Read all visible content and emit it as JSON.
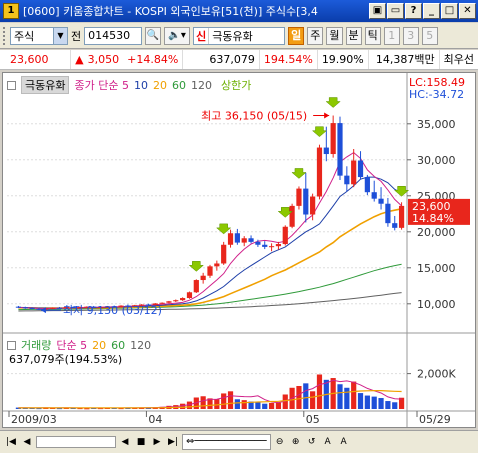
{
  "window": {
    "icon": "1",
    "title": "[0600] 키움종합차트 - KOSPI 외국인보유[51(천)] 주식수[3,4",
    "buttons": [
      "▣",
      "▭",
      "?",
      "_",
      "□",
      "✕"
    ]
  },
  "toolbar": {
    "market": "주식",
    "jeon_label": "전",
    "code": "014530",
    "sin_badge": "신",
    "stock_name": "극동유화",
    "periods": [
      {
        "label": "일",
        "active": true
      },
      {
        "label": "주",
        "active": false
      },
      {
        "label": "월",
        "active": false
      },
      {
        "label": "분",
        "active": false
      },
      {
        "label": "틱",
        "active": false
      },
      {
        "label": "1",
        "active": false
      },
      {
        "label": "3",
        "active": false
      },
      {
        "label": "5",
        "active": false
      }
    ]
  },
  "quote": {
    "price": "23,600",
    "change": "3,050",
    "change_pct": "+14.84%",
    "volume": "637,079",
    "volume_ratio": "194.54%",
    "turnover": "19.90%",
    "amount": "14,387백만",
    "extra": "최우선"
  },
  "chart": {
    "legend": {
      "ticker": "극동유화",
      "ma_label": "종가 단순 5",
      "ma10": "10",
      "ma20": "20",
      "ma60": "60",
      "ma120": "120",
      "upper_limit": "상한가"
    },
    "lc": "LC:158.49",
    "hc": "HC:-34.72",
    "high_label": "최고 36,150 (05/15)",
    "low_label": "최저 9,130 (03/12)",
    "current_price": "23,600",
    "current_pct": "14.84%",
    "volume_legend": {
      "label": "거래량",
      "ma": "단순 5",
      "ma20": "20",
      "ma60": "60",
      "ma120": "120",
      "value": "637,079주(194.53%)"
    },
    "x_labels": [
      "2009/03",
      "04",
      "05",
      "05/29"
    ],
    "colors": {
      "up": "#e8261c",
      "down": "#1e4fd8",
      "ma5": "#d0208a",
      "ma10": "#1e3fa8",
      "ma20": "#f0a000",
      "ma60": "#2f9a3a",
      "ma120": "#606060"
    }
  },
  "chart_data": {
    "type": "candlestick",
    "price_axis": [
      35000,
      30000,
      25000,
      20000,
      15000,
      10000
    ],
    "price_ylim": [
      6500,
      39000
    ],
    "volume_axis": [
      "2,000K"
    ],
    "volume_ylim": [
      0,
      2600
    ],
    "candles": [
      [
        9600,
        9700,
        9400,
        9500
      ],
      [
        9500,
        9600,
        9300,
        9400
      ],
      [
        9400,
        9500,
        9250,
        9300
      ],
      [
        9300,
        9400,
        9130,
        9200
      ],
      [
        9200,
        9400,
        9150,
        9350
      ],
      [
        9350,
        9500,
        9250,
        9450
      ],
      [
        9450,
        9550,
        9350,
        9400
      ],
      [
        9400,
        9600,
        9300,
        9550
      ],
      [
        9550,
        9650,
        9400,
        9450
      ],
      [
        9450,
        9600,
        9350,
        9500
      ],
      [
        9500,
        9650,
        9400,
        9600
      ],
      [
        9600,
        9700,
        9450,
        9500
      ],
      [
        9500,
        9650,
        9400,
        9550
      ],
      [
        9550,
        9700,
        9450,
        9650
      ],
      [
        9650,
        9750,
        9500,
        9600
      ],
      [
        9600,
        9800,
        9500,
        9750
      ],
      [
        9750,
        9900,
        9650,
        9700
      ],
      [
        9700,
        9850,
        9600,
        9800
      ],
      [
        9800,
        9950,
        9700,
        9900
      ],
      [
        9900,
        10000,
        9750,
        9850
      ],
      [
        9850,
        10100,
        9800,
        10050
      ],
      [
        10050,
        10200,
        9950,
        10150
      ],
      [
        10150,
        10400,
        10050,
        10350
      ],
      [
        10350,
        10600,
        10250,
        10500
      ],
      [
        10500,
        10900,
        10400,
        10800
      ],
      [
        10800,
        11700,
        10700,
        11600
      ],
      [
        11600,
        13400,
        11500,
        13300
      ],
      [
        13300,
        14300,
        12800,
        13900
      ],
      [
        13900,
        15400,
        13600,
        15200
      ],
      [
        15200,
        16000,
        14600,
        15600
      ],
      [
        15600,
        18600,
        15400,
        18200
      ],
      [
        18200,
        20300,
        17800,
        19800
      ],
      [
        19800,
        20400,
        18200,
        18500
      ],
      [
        18500,
        19400,
        18000,
        19100
      ],
      [
        19100,
        19500,
        18400,
        18600
      ],
      [
        18600,
        18900,
        17900,
        18200
      ],
      [
        18200,
        18700,
        17600,
        17900
      ],
      [
        17900,
        18400,
        17300,
        18000
      ],
      [
        18000,
        18600,
        17500,
        18300
      ],
      [
        18300,
        20900,
        18100,
        20700
      ],
      [
        20700,
        23900,
        20500,
        23600
      ],
      [
        23600,
        26300,
        23100,
        26000
      ],
      [
        26000,
        28200,
        21300,
        22400
      ],
      [
        22400,
        25300,
        21600,
        24900
      ],
      [
        24900,
        32100,
        24500,
        31700
      ],
      [
        31700,
        34600,
        29800,
        30800
      ],
      [
        30800,
        36150,
        30300,
        35100
      ],
      [
        35100,
        36000,
        27200,
        27800
      ],
      [
        27800,
        29100,
        25600,
        26600
      ],
      [
        26600,
        31500,
        26200,
        29900
      ],
      [
        29900,
        31200,
        27300,
        27600
      ],
      [
        27600,
        27900,
        25100,
        25500
      ],
      [
        25500,
        27100,
        24200,
        24600
      ],
      [
        24600,
        26200,
        23100,
        23900
      ],
      [
        23900,
        24700,
        20700,
        21200
      ],
      [
        21200,
        22200,
        20200,
        20550
      ],
      [
        20550,
        24100,
        20300,
        23600
      ]
    ],
    "ma5": [
      9500,
      9450,
      9400,
      9360,
      9350,
      9360,
      9390,
      9410,
      9450,
      9480,
      9500,
      9520,
      9540,
      9560,
      9580,
      9600,
      9650,
      9700,
      9760,
      9820,
      9880,
      9940,
      10000,
      10100,
      10200,
      10500,
      11000,
      11700,
      12500,
      13300,
      14200,
      15600,
      16700,
      17600,
      18300,
      18700,
      18800,
      18700,
      18500,
      18700,
      19500,
      20500,
      21600,
      22300,
      24000,
      25600,
      27500,
      29700,
      30400,
      31000,
      30200,
      28600,
      27700,
      27000,
      25800,
      24500,
      23600
    ],
    "ma10": [
      9500,
      9480,
      9450,
      9420,
      9400,
      9390,
      9390,
      9400,
      9410,
      9420,
      9440,
      9460,
      9480,
      9500,
      9520,
      9550,
      9580,
      9620,
      9660,
      9700,
      9750,
      9800,
      9860,
      9930,
      10000,
      10150,
      10400,
      10800,
      11300,
      11800,
      12400,
      13200,
      14000,
      14700,
      15300,
      15900,
      16500,
      17100,
      17500,
      17900,
      18600,
      19300,
      20000,
      20500,
      21100,
      22300,
      23600,
      24900,
      25600,
      26400,
      27300,
      27600,
      27600,
      27300,
      26800,
      25900,
      25400
    ],
    "ma20": [
      9450,
      9440,
      9430,
      9420,
      9410,
      9400,
      9400,
      9400,
      9400,
      9410,
      9420,
      9430,
      9440,
      9450,
      9470,
      9490,
      9510,
      9540,
      9570,
      9600,
      9630,
      9670,
      9710,
      9760,
      9810,
      9880,
      10000,
      10200,
      10450,
      10700,
      11000,
      11400,
      11800,
      12200,
      12600,
      13000,
      13400,
      13900,
      14300,
      14700,
      15200,
      15700,
      16200,
      16700,
      17200,
      17900,
      18500,
      19300,
      19900,
      20500,
      21100,
      21600,
      22100,
      22500,
      22800,
      23000,
      23200
    ],
    "ma60": [
      9200,
      9210,
      9220,
      9230,
      9240,
      9250,
      9260,
      9270,
      9280,
      9290,
      9300,
      9310,
      9330,
      9350,
      9370,
      9390,
      9410,
      9430,
      9450,
      9470,
      9500,
      9530,
      9560,
      9600,
      9640,
      9690,
      9750,
      9820,
      9900,
      9990,
      10100,
      10220,
      10350,
      10480,
      10620,
      10760,
      10900,
      11050,
      11200,
      11350,
      11520,
      11700,
      11900,
      12100,
      12300,
      12550,
      12800,
      13100,
      13400,
      13700,
      14000,
      14300,
      14600,
      14850,
      15100,
      15300,
      15500
    ],
    "ma120": [
      9000,
      9010,
      9020,
      9030,
      9040,
      9050,
      9060,
      9070,
      9080,
      9090,
      9100,
      9110,
      9120,
      9130,
      9140,
      9150,
      9160,
      9170,
      9180,
      9190,
      9200,
      9215,
      9230,
      9250,
      9270,
      9290,
      9310,
      9340,
      9370,
      9400,
      9440,
      9480,
      9520,
      9560,
      9600,
      9650,
      9700,
      9760,
      9820,
      9880,
      9950,
      10020,
      10100,
      10180,
      10260,
      10350,
      10440,
      10540,
      10640,
      10740,
      10850,
      10960,
      11080,
      11200,
      11320,
      11440,
      11550
    ],
    "volume": [
      80,
      60,
      70,
      50,
      90,
      60,
      50,
      70,
      60,
      50,
      40,
      60,
      50,
      70,
      60,
      50,
      80,
      60,
      70,
      90,
      100,
      120,
      180,
      220,
      300,
      420,
      650,
      720,
      600,
      560,
      880,
      1000,
      550,
      500,
      420,
      380,
      300,
      340,
      360,
      820,
      1200,
      1300,
      1450,
      1000,
      1950,
      1650,
      1750,
      1400,
      1200,
      1550,
      900,
      760,
      700,
      620,
      450,
      380,
      637
    ],
    "vol_ma5": [
      70,
      70,
      65,
      62,
      66,
      64,
      62,
      66,
      62,
      58,
      55,
      54,
      52,
      58,
      56,
      58,
      62,
      62,
      66,
      70,
      80,
      94,
      114,
      142,
      184,
      248,
      354,
      470,
      542,
      556,
      642,
      744,
      722,
      702,
      690,
      746,
      530,
      398,
      364,
      440,
      604,
      804,
      1038,
      1154,
      1380,
      1470,
      1620,
      1550,
      1590,
      1510,
      1360,
      1162,
      1030,
      906,
      686,
      582,
      557
    ],
    "vol_ma20": [
      60,
      60,
      60,
      60,
      60,
      60,
      60,
      60,
      60,
      60,
      60,
      60,
      60,
      60,
      60,
      60,
      62,
      64,
      66,
      68,
      70,
      74,
      80,
      88,
      98,
      116,
      146,
      180,
      206,
      232,
      274,
      320,
      344,
      364,
      380,
      396,
      408,
      422,
      436,
      472,
      520,
      576,
      640,
      674,
      748,
      820,
      884,
      920,
      950,
      990,
      1020,
      1030,
      1040,
      1040,
      1020,
      1000,
      990
    ]
  }
}
